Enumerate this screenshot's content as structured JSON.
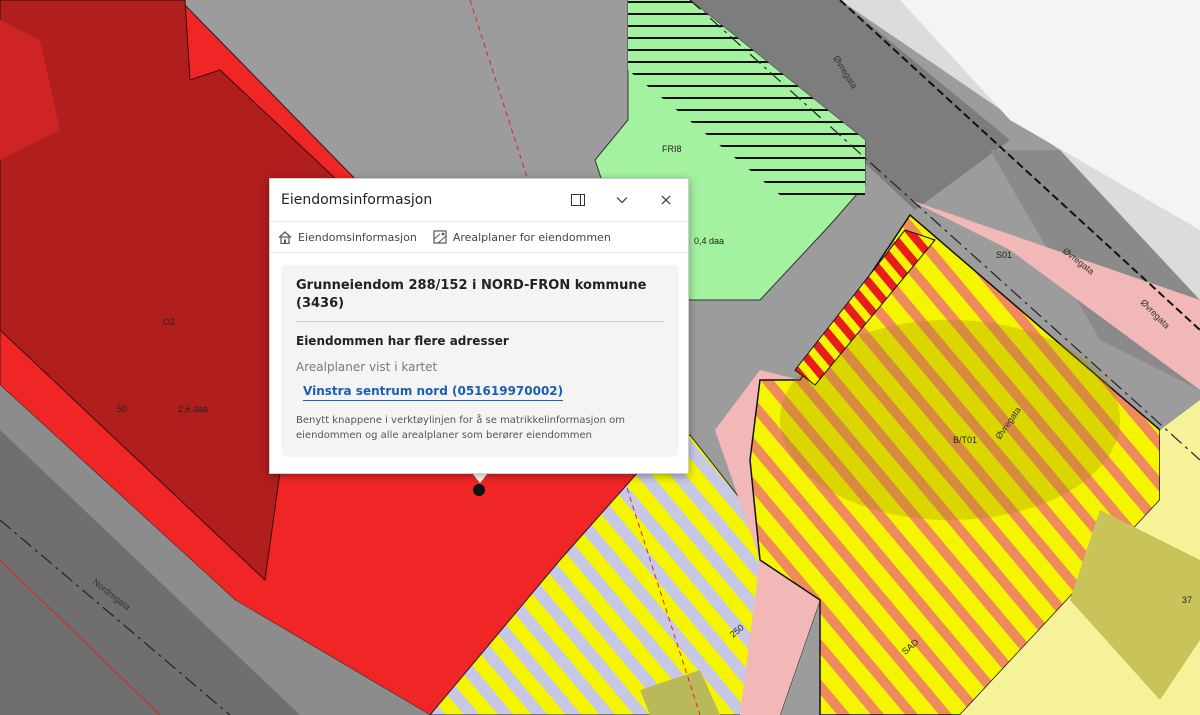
{
  "map": {
    "labels": {
      "o2": "O2",
      "area_o2": "2,6 daa",
      "n50": "50",
      "fri8": "FRI8",
      "area_fri8": "0,4 daa",
      "s01": "S01",
      "bt01": "B/T01",
      "n37": "37",
      "n250": "250",
      "sad": "SAD"
    },
    "roads": {
      "ovregata": "Øvregata",
      "nordregata": "Nordregata"
    },
    "colors": {
      "red_zone": "#f02525",
      "dark_red_zone": "#b11e1e",
      "green_zone": "#a3f2a0",
      "yellow_zone": "#f5f500",
      "pale_yellow": "#f6f29a",
      "pink_zone": "#f2b7b7",
      "lavender_stripe": "#c6c8e6"
    }
  },
  "popup": {
    "title": "Eiendomsinformasjon",
    "icons": {
      "dock": "dock-panel-icon",
      "collapse": "chevron-down-icon",
      "close": "close-icon"
    },
    "tools": [
      {
        "label": "Eiendomsinformasjon",
        "icon": "house-icon"
      },
      {
        "label": "Arealplaner for eiendommen",
        "icon": "plan-map-icon"
      }
    ],
    "property_title": "Grunneiendom 288/152 i NORD-FRON kommune (3436)",
    "address_note": "Eiendommen har flere adresser",
    "plans_label": "Arealplaner vist i kartet",
    "plan_link": "Vinstra sentrum nord (051619970002)",
    "help_text": "Benytt knappene i verktøylinjen for å se matrikkelinformasjon om eiendommen og alle arealplaner som berører eiendommen"
  }
}
